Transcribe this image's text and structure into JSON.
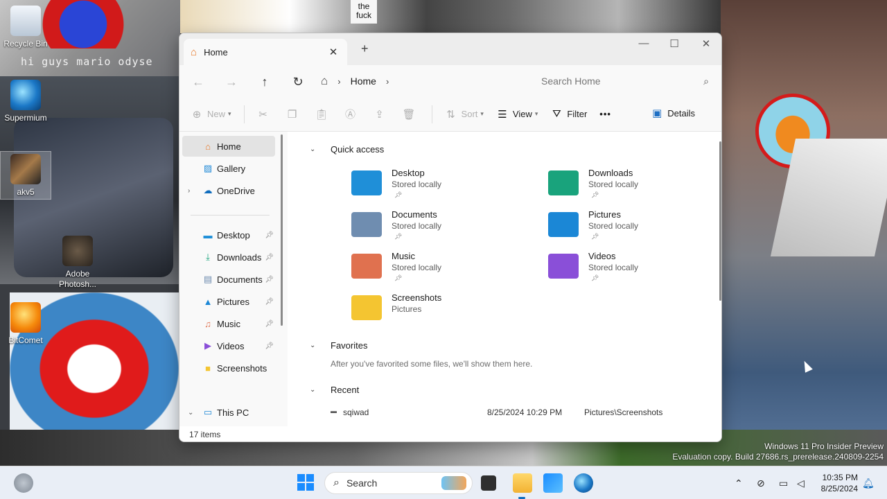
{
  "desktop": {
    "caption": "hi guys mario odyse",
    "sign_text": "the fuck",
    "icons": [
      {
        "label": "Recycle Bin"
      },
      {
        "label": "Supermium"
      },
      {
        "label": "akv5"
      },
      {
        "label": "Adobe Photosh..."
      },
      {
        "label": "BitComet"
      }
    ],
    "watermark": {
      "line1": "Windows 11 Pro Insider Preview",
      "line2": "Evaluation copy. Build 27686.rs_prerelease.240809-2254"
    }
  },
  "explorer": {
    "tab": {
      "label": "Home",
      "close": "✕"
    },
    "new_tab": "+",
    "window_controls": {
      "minimize": "—",
      "maximize": "☐",
      "close": "✕"
    },
    "breadcrumb": [
      "Home"
    ],
    "search_placeholder": "Search Home",
    "commands": {
      "new": "New",
      "sort": "Sort",
      "view": "View",
      "filter": "Filter",
      "more": "•••",
      "details": "Details"
    },
    "nav": [
      {
        "label": "Home",
        "icon": "home-icon"
      },
      {
        "label": "Gallery",
        "icon": "gallery-icon"
      },
      {
        "label": "OneDrive",
        "icon": "onedrive-icon"
      },
      {
        "label": "Desktop",
        "icon": "desktop-icon"
      },
      {
        "label": "Downloads",
        "icon": "download-icon"
      },
      {
        "label": "Documents",
        "icon": "document-icon"
      },
      {
        "label": "Pictures",
        "icon": "picture-icon"
      },
      {
        "label": "Music",
        "icon": "music-icon"
      },
      {
        "label": "Videos",
        "icon": "video-icon"
      },
      {
        "label": "Screenshots",
        "icon": "folder-icon"
      },
      {
        "label": "This PC",
        "icon": "pc-icon"
      }
    ],
    "sections": {
      "quick_access": "Quick access",
      "favorites": "Favorites",
      "favorites_empty": "After you've favorited some files, we'll show them here.",
      "recent": "Recent"
    },
    "quick_access": [
      {
        "name": "Desktop",
        "sub": "Stored locally",
        "color": "#1f8fd8"
      },
      {
        "name": "Downloads",
        "sub": "Stored locally",
        "color": "#19a37c"
      },
      {
        "name": "Documents",
        "sub": "Stored locally",
        "color": "#6f8db0"
      },
      {
        "name": "Pictures",
        "sub": "Stored locally",
        "color": "#1b87d6"
      },
      {
        "name": "Music",
        "sub": "Stored locally",
        "color": "#e0714f"
      },
      {
        "name": "Videos",
        "sub": "Stored locally",
        "color": "#8a4fd8"
      },
      {
        "name": "Screenshots",
        "sub": "Pictures",
        "color": "#f4c531"
      }
    ],
    "recent": [
      {
        "name": "sqiwad",
        "date": "8/25/2024 10:29 PM",
        "location": "Pictures\\Screenshots"
      }
    ],
    "status": "17 items"
  },
  "taskbar": {
    "search_label": "Search",
    "time": "10:35 PM",
    "date": "8/25/2024"
  }
}
